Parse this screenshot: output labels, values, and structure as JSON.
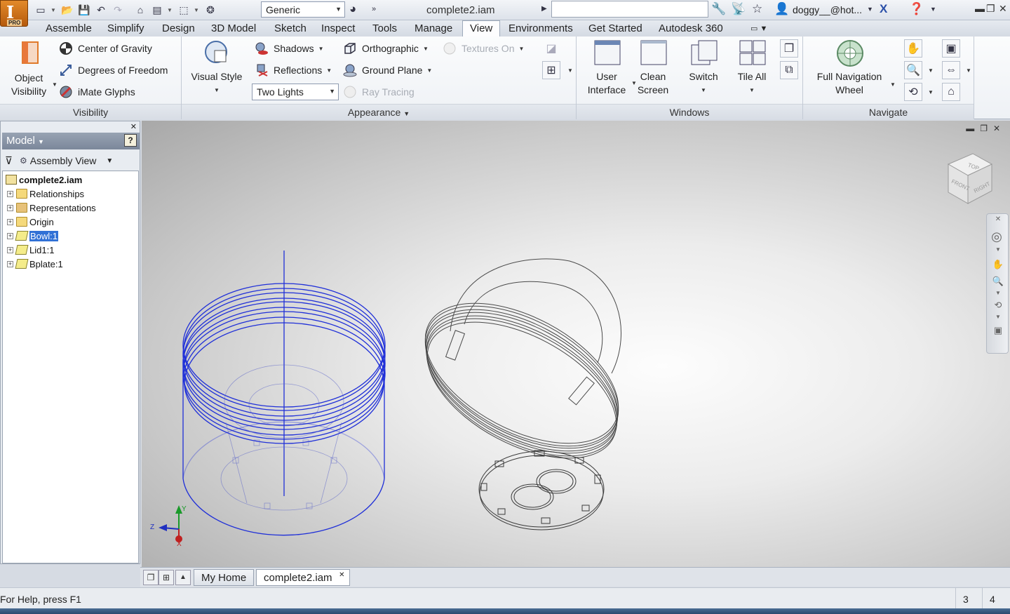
{
  "app": {
    "badge": "PRO",
    "document_title": "complete2.iam",
    "material_combo": "Generic",
    "user_name": "doggy__@hot..."
  },
  "tabs": [
    "Assemble",
    "Simplify",
    "Design",
    "3D Model",
    "Sketch",
    "Inspect",
    "Tools",
    "Manage",
    "View",
    "Environments",
    "Get Started",
    "Autodesk 360"
  ],
  "active_tab": "View",
  "ribbon": {
    "visibility": {
      "title": "Visibility",
      "object_visibility": [
        "Object",
        "Visibility"
      ],
      "center_of_gravity": "Center of Gravity",
      "degrees_of_freedom": "Degrees of Freedom",
      "imate_glyphs": "iMate Glyphs"
    },
    "appearance": {
      "title": "Appearance",
      "visual_style": "Visual Style",
      "shadows": "Shadows",
      "reflections": "Reflections",
      "lighting_combo": "Two Lights",
      "orthographic": "Orthographic",
      "ground_plane": "Ground Plane",
      "textures_on": "Textures On",
      "ray_tracing": "Ray Tracing"
    },
    "windows": {
      "title": "Windows",
      "user_interface": [
        "User",
        "Interface"
      ],
      "clean_screen": [
        "Clean",
        "Screen"
      ],
      "switch": "Switch",
      "tile_all": "Tile All"
    },
    "navigate": {
      "title": "Navigate",
      "full_nav_wheel": [
        "Full Navigation",
        "Wheel"
      ]
    }
  },
  "browser": {
    "header": "Model",
    "view": "Assembly View",
    "help": "?",
    "root": "complete2.iam",
    "items": [
      {
        "label": "Relationships",
        "type": "folder"
      },
      {
        "label": "Representations",
        "type": "folder"
      },
      {
        "label": "Origin",
        "type": "folder"
      },
      {
        "label": "Bowl:1",
        "type": "part",
        "selected": true
      },
      {
        "label": "Lid1:1",
        "type": "part"
      },
      {
        "label": "Bplate:1",
        "type": "part"
      }
    ]
  },
  "viewcube": {
    "top": "TOP",
    "front": "FRONT",
    "right": "RIGHT"
  },
  "triad": {
    "x": "X",
    "y": "Y",
    "z": "Z"
  },
  "doc_tabs": [
    "My Home",
    "complete2.iam"
  ],
  "status": {
    "help_text": "For Help, press F1",
    "count_a": "3",
    "count_b": "4"
  },
  "colors": {
    "selected_wire": "#1f2fd8",
    "wire": "#4a4a4a",
    "accent": "#3171d6"
  }
}
